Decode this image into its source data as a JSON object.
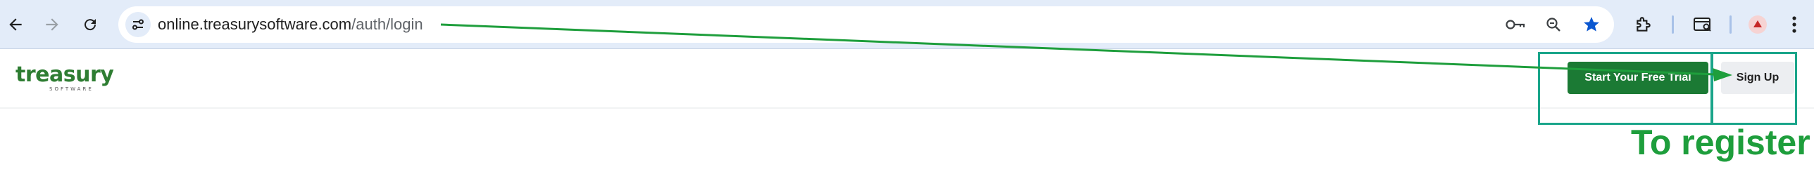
{
  "browser": {
    "url_host": "online.treasurysoftware.com",
    "url_path": "/auth/login",
    "nav": {
      "back_icon": "arrow-left-icon",
      "forward_icon": "arrow-right-icon",
      "reload_icon": "reload-icon"
    },
    "omnibox_icons": [
      "site-info-icon",
      "key-icon",
      "zoom-out-icon",
      "star-icon"
    ],
    "toolbar_icons": [
      "extensions-icon",
      "tab-search-icon",
      "profile-avatar",
      "kebab-menu-icon"
    ],
    "accent_color": "#0b57d0"
  },
  "page": {
    "logo_text": "treasury",
    "logo_subtext": "SOFTWARE",
    "brand_color": "#1b7a34",
    "buttons": {
      "trial_label": "Start Your Free Trial",
      "signup_label": "Sign Up"
    }
  },
  "annotation": {
    "label": "To register",
    "color": "#1e9e3c",
    "box_color": "#1aa58a"
  }
}
